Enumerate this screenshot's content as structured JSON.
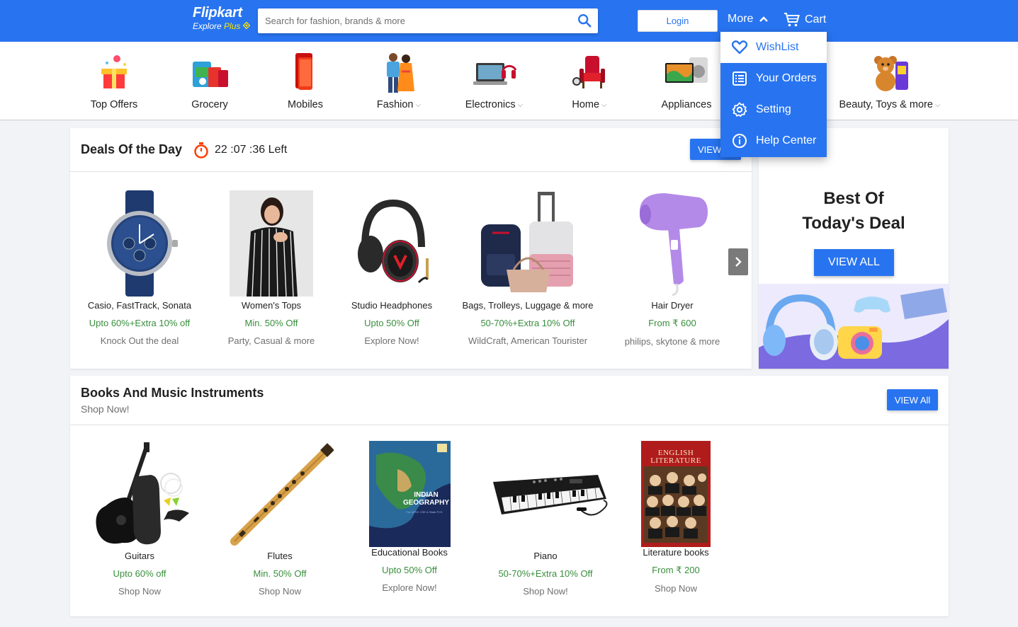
{
  "header": {
    "brand": "Flipkart",
    "tagline": "Explore",
    "tagline_plus": "Plus",
    "search_placeholder": "Search for fashion, brands & more",
    "login_label": "Login",
    "more_label": "More",
    "cart_label": "Cart"
  },
  "categories": [
    {
      "label": "Top Offers",
      "icon": "gift-icon",
      "dropdown": false
    },
    {
      "label": "Grocery",
      "icon": "grocery-icon",
      "dropdown": false
    },
    {
      "label": "Mobiles",
      "icon": "mobile-icon",
      "dropdown": false
    },
    {
      "label": "Fashion",
      "icon": "fashion-icon",
      "dropdown": true
    },
    {
      "label": "Electronics",
      "icon": "laptop-icon",
      "dropdown": true
    },
    {
      "label": "Home",
      "icon": "armchair-icon",
      "dropdown": true
    },
    {
      "label": "Appliances",
      "icon": "tv-icon",
      "dropdown": false
    },
    {
      "label": "Beauty, Toys & more",
      "icon": "teddy-icon",
      "dropdown": true
    }
  ],
  "more_menu": [
    {
      "label": "WishList",
      "icon": "heart-icon"
    },
    {
      "label": "Your Orders",
      "icon": "orders-icon"
    },
    {
      "label": "Setting",
      "icon": "gear-icon"
    },
    {
      "label": "Help Center",
      "icon": "info-icon"
    }
  ],
  "deals": {
    "title": "Deals Of the Day",
    "timer": "22 :07 :36 Left",
    "view_all": "VIEW ALL",
    "products": [
      {
        "name": "Casio, FastTrack, Sonata",
        "offer": "Upto 60%+Extra 10% off",
        "sub": "Knock Out the deal"
      },
      {
        "name": "Women's Tops",
        "offer": "Min. 50% Off",
        "sub": "Party, Casual & more"
      },
      {
        "name": "Studio Headphones",
        "offer": "Upto 50% Off",
        "sub": "Explore Now!"
      },
      {
        "name": "Bags, Trolleys, Luggage & more",
        "offer": "50-70%+Extra 10% Off",
        "sub": "WildCraft, American Tourister"
      },
      {
        "name": "Hair Dryer",
        "offer": "From ₹ 600",
        "sub": "philips, skytone & more"
      }
    ]
  },
  "banner": {
    "title_line1": "Best Of",
    "title_line2": "Today's Deal",
    "button": "VIEW ALL"
  },
  "books": {
    "title": "Books And Music Instruments",
    "subtitle": "Shop Now!",
    "view_all": "VIEW All",
    "products": [
      {
        "name": "Guitars",
        "offer": "Upto 60% off",
        "sub": "Shop Now"
      },
      {
        "name": "Flutes",
        "offer": "Min. 50% Off",
        "sub": "Shop Now"
      },
      {
        "name": "Educational Books",
        "offer": "Upto 50% Off",
        "sub": "Explore Now!"
      },
      {
        "name": "Piano",
        "offer": "50-70%+Extra 10% Off",
        "sub": "Shop Now!"
      },
      {
        "name": "Literature books",
        "offer": "From ₹ 200",
        "sub": "Shop Now"
      }
    ],
    "geo_book_title": "INDIAN GEOGRAPHY",
    "lit_book_title": "ENGLISH LITERATURE"
  },
  "colors": {
    "primary": "#2874f0",
    "offer_green": "#388e3c",
    "timer_red": "#ff3d00"
  }
}
